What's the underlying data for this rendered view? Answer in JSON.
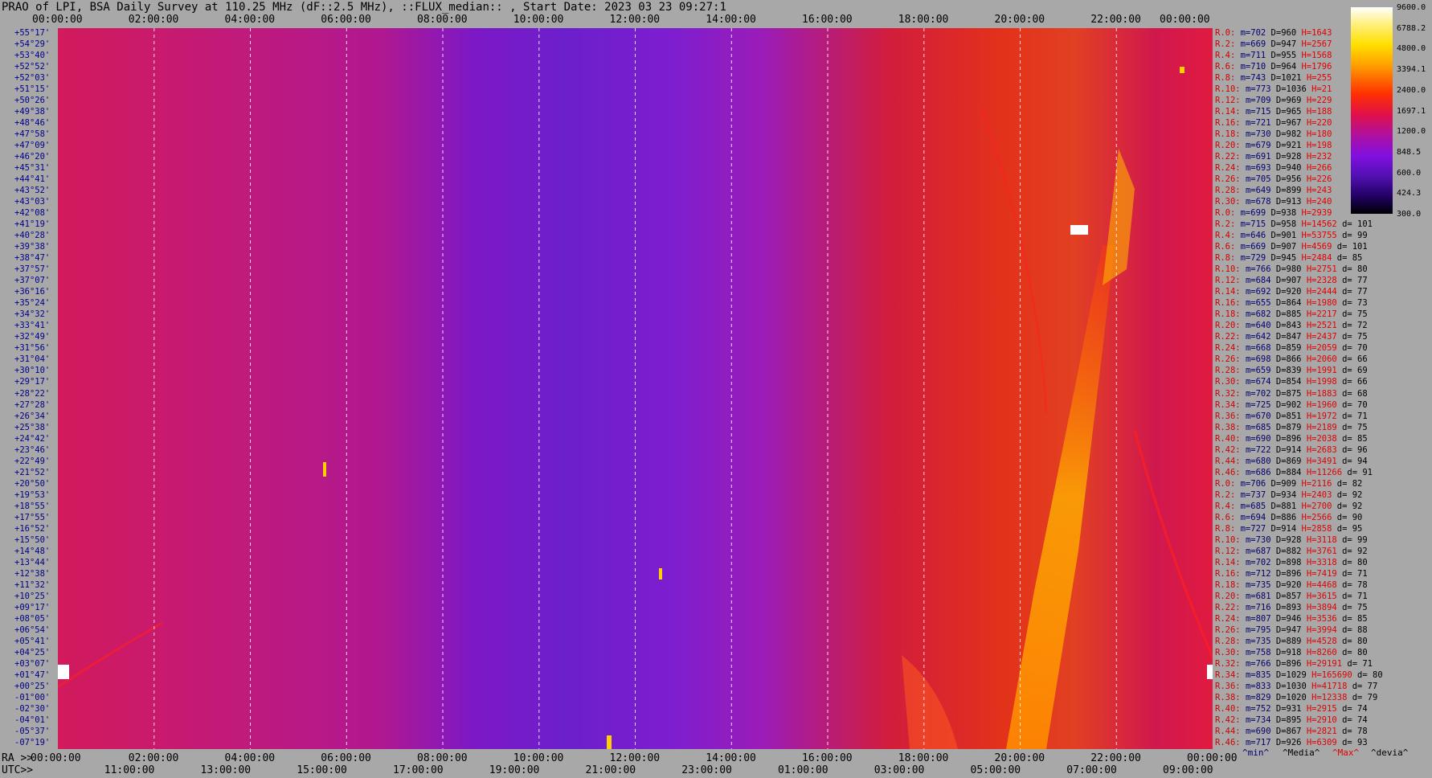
{
  "title": "PRAO of LPI, BSA Daily Survey at 110.25 MHz (dF::2.5 MHz), ::FLUX_median:: , Start Date: 2023 03 23 09:27:1",
  "utc_top": [
    "00:00:00",
    "02:00:00",
    "04:00:00",
    "06:00:00",
    "08:00:00",
    "10:00:00",
    "12:00:00",
    "14:00:00",
    "16:00:00",
    "18:00:00",
    "20:00:00",
    "22:00:00",
    "00:00:00"
  ],
  "ra_bottom": [
    "00:00:00",
    "02:00:00",
    "04:00:00",
    "06:00:00",
    "08:00:00",
    "10:00:00",
    "12:00:00",
    "14:00:00",
    "16:00:00",
    "18:00:00",
    "20:00:00",
    "22:00:00",
    "00:00:00"
  ],
  "utc_bottom": [
    "11:00:00",
    "13:00:00",
    "15:00:00",
    "17:00:00",
    "19:00:00",
    "21:00:00",
    "23:00:00",
    "01:00:00",
    "03:00:00",
    "05:00:00",
    "07:00:00",
    "09:00:00"
  ],
  "ra_prefix": "RA >>",
  "utc_prefix": "UTC>>",
  "footer_labels": {
    "min": "^min^",
    "media": "^Media^",
    "max": "^Max^",
    "devia": "^devia^"
  },
  "declinations": [
    "+55°17'",
    "+54°29'",
    "+53°40'",
    "+52°52'",
    "+52°03'",
    "+51°15'",
    "+50°26'",
    "+49°38'",
    "+48°46'",
    "+47°58'",
    "+47°09'",
    "+46°20'",
    "+45°31'",
    "+44°41'",
    "+43°52'",
    "+43°03'",
    "+42°08'",
    "+41°19'",
    "+40°28'",
    "+39°38'",
    "+38°47'",
    "+37°57'",
    "+37°07'",
    "+36°16'",
    "+35°24'",
    "+34°32'",
    "+33°41'",
    "+32°49'",
    "+31°56'",
    "+31°04'",
    "+30°10'",
    "+29°17'",
    "+28°22'",
    "+27°28'",
    "+26°34'",
    "+25°38'",
    "+24°42'",
    "+23°46'",
    "+22°49'",
    "+21°52'",
    "+20°50'",
    "+19°53'",
    "+18°55'",
    "+17°55'",
    "+16°52'",
    "+15°50'",
    "+14°48'",
    "+13°44'",
    "+12°38'",
    "+11°32'",
    "+10°25'",
    "+09°17'",
    "+08°05'",
    "+06°54'",
    "+05°41'",
    "+04°25'",
    "+03°07'",
    "+01°47'",
    "+00°25'",
    "-01°00'",
    "-02°30'",
    "-04°01'",
    "-05°37'",
    "-07°19'"
  ],
  "colorbar": {
    "values": [
      "9600.0",
      "6788.2",
      "4800.0",
      "3394.1",
      "2400.0",
      "1697.1",
      "1200.0",
      "848.5",
      "600.0",
      "424.3",
      "300.0"
    ]
  },
  "stats": [
    {
      "r": "R.0:",
      "m": "m=702",
      "d": "D=960",
      "h": "H=1643",
      "dv": ""
    },
    {
      "r": "R.2:",
      "m": "m=669",
      "d": "D=947",
      "h": "H=2567",
      "dv": ""
    },
    {
      "r": "R.4:",
      "m": "m=711",
      "d": "D=955",
      "h": "H=1568",
      "dv": ""
    },
    {
      "r": "R.6:",
      "m": "m=710",
      "d": "D=964",
      "h": "H=1796",
      "dv": ""
    },
    {
      "r": "R.8:",
      "m": "m=743",
      "d": "D=1021",
      "h": "H=255",
      "dv": ""
    },
    {
      "r": "R.10:",
      "m": "m=773",
      "d": "D=1036",
      "h": "H=21",
      "dv": ""
    },
    {
      "r": "R.12:",
      "m": "m=709",
      "d": "D=969",
      "h": "H=229",
      "dv": ""
    },
    {
      "r": "R.14:",
      "m": "m=715",
      "d": "D=965",
      "h": "H=188",
      "dv": ""
    },
    {
      "r": "R.16:",
      "m": "m=721",
      "d": "D=967",
      "h": "H=220",
      "dv": ""
    },
    {
      "r": "R.18:",
      "m": "m=730",
      "d": "D=982",
      "h": "H=180",
      "dv": ""
    },
    {
      "r": "R.20:",
      "m": "m=679",
      "d": "D=921",
      "h": "H=198",
      "dv": ""
    },
    {
      "r": "R.22:",
      "m": "m=691",
      "d": "D=928",
      "h": "H=232",
      "dv": ""
    },
    {
      "r": "R.24:",
      "m": "m=693",
      "d": "D=940",
      "h": "H=266",
      "dv": ""
    },
    {
      "r": "R.26:",
      "m": "m=705",
      "d": "D=956",
      "h": "H=226",
      "dv": ""
    },
    {
      "r": "R.28:",
      "m": "m=649",
      "d": "D=899",
      "h": "H=243",
      "dv": ""
    },
    {
      "r": "R.30:",
      "m": "m=678",
      "d": "D=913",
      "h": "H=240",
      "dv": ""
    },
    {
      "r": "R.0:",
      "m": "m=699",
      "d": "D=938",
      "h": "H=2939",
      "dv": ""
    },
    {
      "r": "R.2:",
      "m": "m=715",
      "d": "D=958",
      "h": "H=14562",
      "dv": "d= 101"
    },
    {
      "r": "R.4:",
      "m": "m=646",
      "d": "D=901",
      "h": "H=53755",
      "dv": "d= 99"
    },
    {
      "r": "R.6:",
      "m": "m=669",
      "d": "D=907",
      "h": "H=4569",
      "dv": "d= 101"
    },
    {
      "r": "R.8:",
      "m": "m=729",
      "d": "D=945",
      "h": "H=2484",
      "dv": "d= 85"
    },
    {
      "r": "R.10:",
      "m": "m=766",
      "d": "D=980",
      "h": "H=2751",
      "dv": "d= 80"
    },
    {
      "r": "R.12:",
      "m": "m=684",
      "d": "D=907",
      "h": "H=2328",
      "dv": "d= 77"
    },
    {
      "r": "R.14:",
      "m": "m=692",
      "d": "D=920",
      "h": "H=2444",
      "dv": "d= 77"
    },
    {
      "r": "R.16:",
      "m": "m=655",
      "d": "D=864",
      "h": "H=1980",
      "dv": "d= 73"
    },
    {
      "r": "R.18:",
      "m": "m=682",
      "d": "D=885",
      "h": "H=2217",
      "dv": "d= 75"
    },
    {
      "r": "R.20:",
      "m": "m=640",
      "d": "D=843",
      "h": "H=2521",
      "dv": "d= 72"
    },
    {
      "r": "R.22:",
      "m": "m=642",
      "d": "D=847",
      "h": "H=2437",
      "dv": "d= 75"
    },
    {
      "r": "R.24:",
      "m": "m=668",
      "d": "D=859",
      "h": "H=2059",
      "dv": "d= 70"
    },
    {
      "r": "R.26:",
      "m": "m=698",
      "d": "D=866",
      "h": "H=2060",
      "dv": "d= 66"
    },
    {
      "r": "R.28:",
      "m": "m=659",
      "d": "D=839",
      "h": "H=1991",
      "dv": "d= 69"
    },
    {
      "r": "R.30:",
      "m": "m=674",
      "d": "D=854",
      "h": "H=1998",
      "dv": "d= 66"
    },
    {
      "r": "R.32:",
      "m": "m=702",
      "d": "D=875",
      "h": "H=1883",
      "dv": "d= 68"
    },
    {
      "r": "R.34:",
      "m": "m=725",
      "d": "D=902",
      "h": "H=1960",
      "dv": "d= 70"
    },
    {
      "r": "R.36:",
      "m": "m=670",
      "d": "D=851",
      "h": "H=1972",
      "dv": "d= 71"
    },
    {
      "r": "R.38:",
      "m": "m=685",
      "d": "D=879",
      "h": "H=2189",
      "dv": "d= 75"
    },
    {
      "r": "R.40:",
      "m": "m=690",
      "d": "D=896",
      "h": "H=2038",
      "dv": "d= 85"
    },
    {
      "r": "R.42:",
      "m": "m=722",
      "d": "D=914",
      "h": "H=2683",
      "dv": "d= 96"
    },
    {
      "r": "R.44:",
      "m": "m=680",
      "d": "D=869",
      "h": "H=3491",
      "dv": "d= 94"
    },
    {
      "r": "R.46:",
      "m": "m=686",
      "d": "D=884",
      "h": "H=11266",
      "dv": "d= 91"
    },
    {
      "r": "R.0:",
      "m": "m=706",
      "d": "D=909",
      "h": "H=2116",
      "dv": "d= 82"
    },
    {
      "r": "R.2:",
      "m": "m=737",
      "d": "D=934",
      "h": "H=2403",
      "dv": "d= 92"
    },
    {
      "r": "R.4:",
      "m": "m=685",
      "d": "D=881",
      "h": "H=2700",
      "dv": "d= 92"
    },
    {
      "r": "R.6:",
      "m": "m=694",
      "d": "D=886",
      "h": "H=2566",
      "dv": "d= 90"
    },
    {
      "r": "R.8:",
      "m": "m=727",
      "d": "D=914",
      "h": "H=2858",
      "dv": "d= 95"
    },
    {
      "r": "R.10:",
      "m": "m=730",
      "d": "D=928",
      "h": "H=3118",
      "dv": "d= 99"
    },
    {
      "r": "R.12:",
      "m": "m=687",
      "d": "D=882",
      "h": "H=3761",
      "dv": "d= 92"
    },
    {
      "r": "R.14:",
      "m": "m=702",
      "d": "D=898",
      "h": "H=3318",
      "dv": "d= 80"
    },
    {
      "r": "R.16:",
      "m": "m=712",
      "d": "D=896",
      "h": "H=7419",
      "dv": "d= 71"
    },
    {
      "r": "R.18:",
      "m": "m=735",
      "d": "D=920",
      "h": "H=4468",
      "dv": "d= 78"
    },
    {
      "r": "R.20:",
      "m": "m=681",
      "d": "D=857",
      "h": "H=3615",
      "dv": "d= 71"
    },
    {
      "r": "R.22:",
      "m": "m=716",
      "d": "D=893",
      "h": "H=3894",
      "dv": "d= 75"
    },
    {
      "r": "R.24:",
      "m": "m=807",
      "d": "D=946",
      "h": "H=3536",
      "dv": "d= 85"
    },
    {
      "r": "R.26:",
      "m": "m=795",
      "d": "D=947",
      "h": "H=3994",
      "dv": "d= 88"
    },
    {
      "r": "R.28:",
      "m": "m=735",
      "d": "D=889",
      "h": "H=4528",
      "dv": "d= 80"
    },
    {
      "r": "R.30:",
      "m": "m=758",
      "d": "D=918",
      "h": "H=8260",
      "dv": "d= 80"
    },
    {
      "r": "R.32:",
      "m": "m=766",
      "d": "D=896",
      "h": "H=29191",
      "dv": "d= 71"
    },
    {
      "r": "R.34:",
      "m": "m=835",
      "d": "D=1029",
      "h": "H=165690",
      "dv": "d= 80"
    },
    {
      "r": "R.36:",
      "m": "m=833",
      "d": "D=1030",
      "h": "H=41718",
      "dv": "d= 77"
    },
    {
      "r": "R.38:",
      "m": "m=829",
      "d": "D=1020",
      "h": "H=12338",
      "dv": "d= 79"
    },
    {
      "r": "R.40:",
      "m": "m=752",
      "d": "D=931",
      "h": "H=2915",
      "dv": "d= 74"
    },
    {
      "r": "R.42:",
      "m": "m=734",
      "d": "D=895",
      "h": "H=2910",
      "dv": "d= 74"
    },
    {
      "r": "R.44:",
      "m": "m=690",
      "d": "D=867",
      "h": "H=2821",
      "dv": "d= 78"
    },
    {
      "r": "R.46:",
      "m": "m=717",
      "d": "D=926",
      "h": "H=6309",
      "dv": "d= 93"
    }
  ],
  "chart_data": {
    "type": "heatmap",
    "title": "PRAO of LPI, BSA Daily Survey at 110.25 MHz (dF::2.5 MHz), ::FLUX_median:: , Start Date: 2023 03 23 09:27:1",
    "x_axis_top": "UTC 00:00:00 - 00:00:00",
    "x_axis_bottom_ra": "RA 00:00:00 - 00:00:00",
    "y_axis": "Declination +55°17' to -07°19'",
    "colorbar_range": [
      300.0,
      9600.0
    ],
    "colorbar_ticks": [
      9600.0,
      6788.2,
      4800.0,
      3394.1,
      2400.0,
      1697.1,
      1200.0,
      848.5,
      600.0,
      424.3,
      300.0
    ],
    "colormap": [
      "#000000",
      "#200060",
      "#5010b0",
      "#8010e0",
      "#b010a0",
      "#e0104a",
      "#ff3000",
      "#ffa000",
      "#ffe000",
      "#fff080",
      "#ffffff"
    ]
  }
}
